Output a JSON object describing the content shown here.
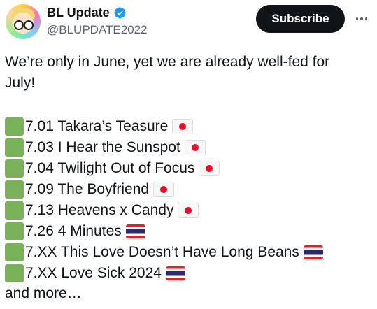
{
  "author": {
    "display_name": "BL Update",
    "handle": "@BLUPDATE2022",
    "verified": true,
    "verified_color": "#1d9bf0"
  },
  "actions": {
    "subscribe_label": "Subscribe",
    "more_icon": "more-horizontal-icon"
  },
  "post": {
    "intro": "We’re only in June, yet we are already well-fed for July!",
    "items": [
      {
        "text": "7.01 Takara’s Teasure",
        "flag": "japan-flag-icon"
      },
      {
        "text": "7.03 I Hear the Sunspot",
        "flag": "japan-flag-icon"
      },
      {
        "text": "7.04 Twilight Out of Focus",
        "flag": "japan-flag-icon"
      },
      {
        "text": "7.09 The Boyfriend",
        "flag": "japan-flag-icon"
      },
      {
        "text": "7.13 Heavens x Candy",
        "flag": "japan-flag-icon"
      },
      {
        "text": "7.26 4 Minutes",
        "flag": "thailand-flag-icon"
      },
      {
        "text": "7.XX This Love Doesn’t Have Long Beans",
        "flag": "thailand-flag-icon"
      },
      {
        "text": "7.XX Love Sick 2024",
        "flag": "thailand-flag-icon"
      }
    ],
    "outro": "and more…"
  },
  "colors": {
    "bullet_green": "#78b159",
    "text": "#0f1419",
    "muted": "#536471",
    "button_bg": "#0f1419"
  }
}
